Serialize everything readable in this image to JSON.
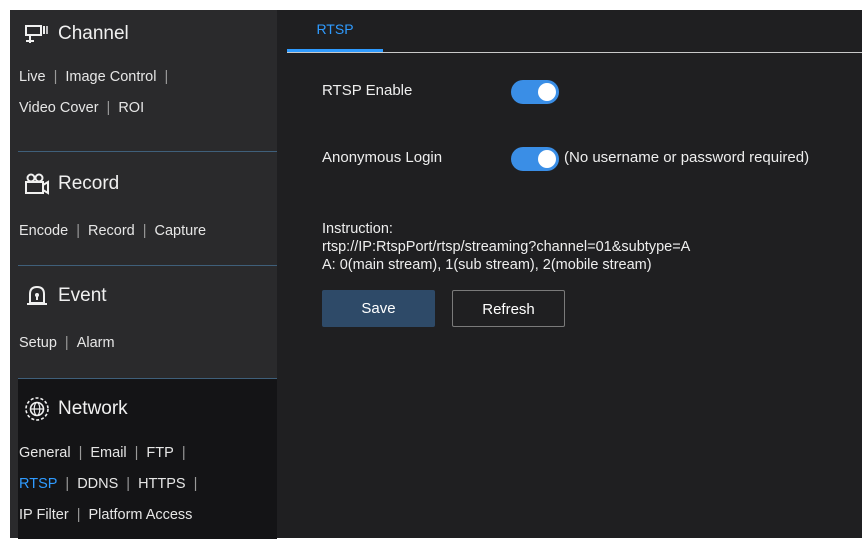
{
  "sidebar": {
    "sections": [
      {
        "title": "Channel",
        "icon": "camera-channel-icon",
        "links": [
          [
            "Live",
            "Image Control"
          ],
          [
            "Video Cover",
            "ROI"
          ]
        ]
      },
      {
        "title": "Record",
        "icon": "video-camera-icon",
        "links": [
          [
            "Encode",
            "Record",
            "Capture"
          ]
        ]
      },
      {
        "title": "Event",
        "icon": "alarm-bell-icon",
        "links": [
          [
            "Setup",
            "Alarm"
          ]
        ]
      },
      {
        "title": "Network",
        "icon": "globe-network-icon",
        "links": [
          [
            "General",
            "Email",
            "FTP"
          ],
          [
            "RTSP",
            "DDNS",
            "HTTPS"
          ],
          [
            "IP Filter",
            "Platform Access"
          ]
        ]
      }
    ],
    "active_section": "Network",
    "active_link": "RTSP"
  },
  "tabs": [
    "RTSP"
  ],
  "rtsp": {
    "enable_label": "RTSP Enable",
    "enable_on": true,
    "anon_label": "Anonymous Login",
    "anon_on": true,
    "anon_note": "(No username or password required)",
    "instruction_title": "Instruction:",
    "instruction_url": "rtsp://IP:RtspPort/rtsp/streaming?channel=01&subtype=A",
    "instruction_streams": "A: 0(main stream), 1(sub stream), 2(mobile stream)"
  },
  "buttons": {
    "save": "Save",
    "refresh": "Refresh"
  },
  "colors": {
    "accent": "#2f9bff",
    "toggle_on": "#3a8ee6",
    "save_button": "#2e4a68"
  }
}
